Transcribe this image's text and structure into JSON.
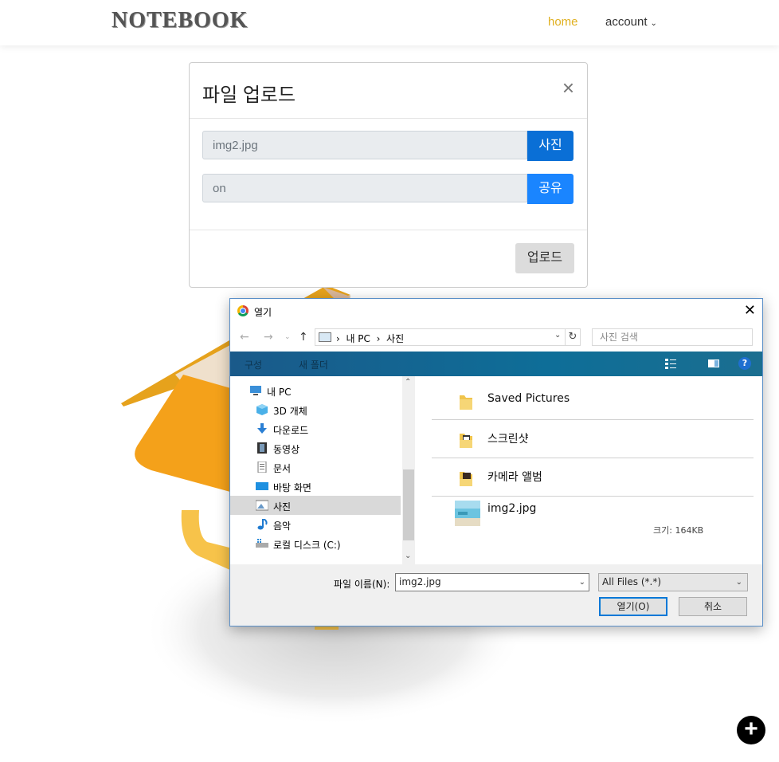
{
  "navbar": {
    "brand": "NOTEBOOK",
    "home": "home",
    "account": "account",
    "home_color": "#e0b020"
  },
  "modal": {
    "title": "파일 업로드",
    "close_icon": "×",
    "photo_input_value": "img2.jpg",
    "photo_button": "사진",
    "share_input_value": "on",
    "share_button": "공유",
    "upload_button": "업로드"
  },
  "dialog": {
    "title": "열기",
    "breadcrumb": [
      "내 PC",
      "사진"
    ],
    "search_placeholder": "사진 검색",
    "toolbar": {
      "organize": "구성",
      "new_folder": "새 폴더"
    },
    "tree": [
      {
        "label": "내 PC",
        "icon": "pc-icon"
      },
      {
        "label": "3D 개체",
        "icon": "cube-icon"
      },
      {
        "label": "다운로드",
        "icon": "download-arrow-icon"
      },
      {
        "label": "동영상",
        "icon": "film-icon"
      },
      {
        "label": "문서",
        "icon": "document-icon"
      },
      {
        "label": "바탕 화면",
        "icon": "desktop-icon"
      },
      {
        "label": "사진",
        "icon": "picture-icon",
        "selected": true
      },
      {
        "label": "음악",
        "icon": "music-note-icon"
      },
      {
        "label": "로컬 디스크 (C:)",
        "icon": "disk-icon"
      }
    ],
    "files": [
      {
        "name": "Saved Pictures",
        "icon": "folder-icon"
      },
      {
        "name": "스크린샷",
        "icon": "folder-icon"
      },
      {
        "name": "카메라 앨범",
        "icon": "folder-icon"
      },
      {
        "name": "img2.jpg",
        "icon": "image-thumbnail-icon",
        "size": "크기: 164KB"
      }
    ],
    "filename_label": "파일 이름(N):",
    "filename_value": "img2.jpg",
    "filetype": "All Files (*.*)",
    "open_button": "열기(O)",
    "cancel_button": "취소",
    "help_icon": "?"
  },
  "fab": {
    "icon": "+"
  }
}
